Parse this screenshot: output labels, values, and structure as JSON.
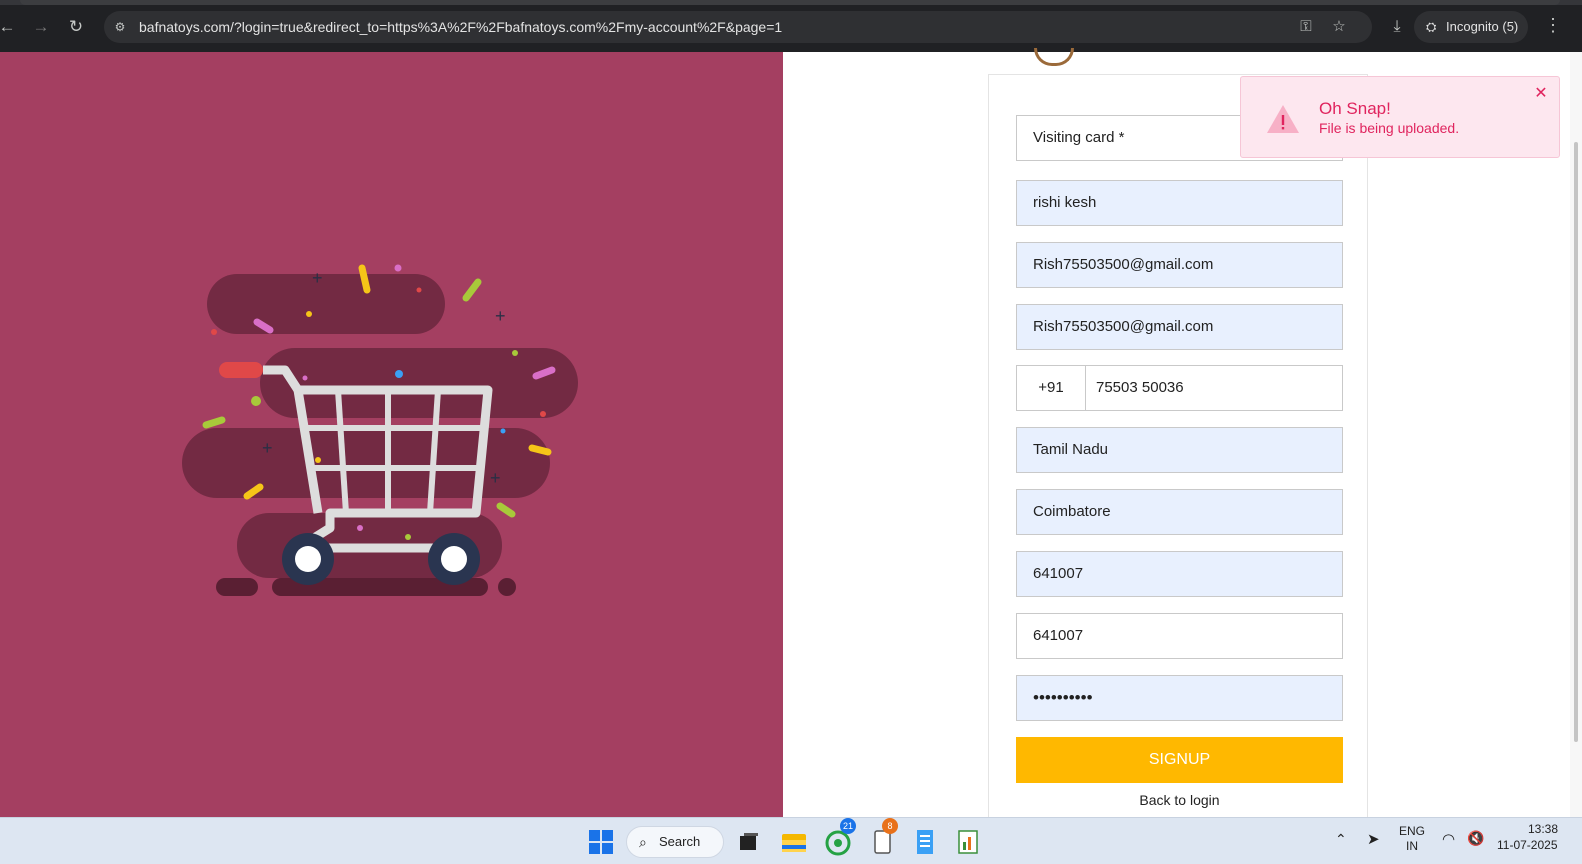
{
  "browser": {
    "url": "bafnatoys.com/?login=true&redirect_to=https%3A%2F%2Fbafnatoys.com%2Fmy-account%2F&page=1",
    "incognito_label": "Incognito (5)"
  },
  "form": {
    "visiting_card_label": "Visiting card *",
    "name": "rishi kesh",
    "email": "Rish75503500@gmail.com",
    "email_confirm": "Rish75503500@gmail.com",
    "phone_code": "+91",
    "phone": "75503 50036",
    "state": "Tamil Nadu",
    "city": "Coimbatore",
    "pincode": "641007",
    "pincode2": "641007",
    "password_masked": "••••••••••",
    "signup_label": "SIGNUP",
    "back_to_login": "Back to login"
  },
  "toast": {
    "title": "Oh Snap!",
    "message": "File is being uploaded."
  },
  "taskbar": {
    "search_label": "Search",
    "whatsapp_badge": "21",
    "notepad_badge": "8",
    "lang_top": "ENG",
    "lang_bottom": "IN",
    "time": "13:38",
    "date": "11-07-2025"
  },
  "colors": {
    "left_panel": "#a43f61",
    "signup_button": "#ffb800",
    "toast_text": "#e0245e",
    "field_autofill": "#e8f0fe"
  },
  "icons": [
    "back-arrow-icon",
    "forward-arrow-icon",
    "reload-icon",
    "site-settings-icon",
    "password-key-icon",
    "bookmark-star-icon",
    "download-icon",
    "incognito-icon",
    "menu-dots-icon",
    "warning-icon",
    "close-icon",
    "windows-start-icon",
    "search-icon",
    "task-view-icon",
    "file-explorer-icon",
    "whatsapp-icon",
    "notepad-icon",
    "notes-icon",
    "chart-app-icon",
    "chevron-up-icon",
    "location-icon",
    "wifi-icon",
    "volume-muted-icon"
  ]
}
